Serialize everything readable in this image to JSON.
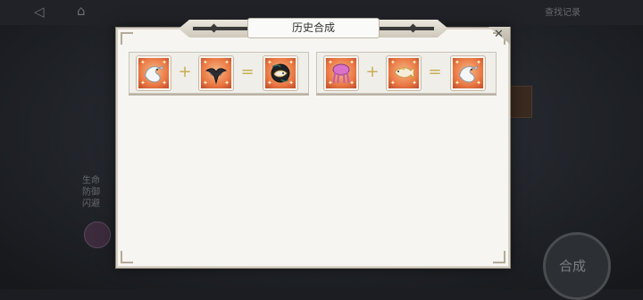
{
  "background": {
    "side_labels": [
      "生命",
      "防御",
      "闪避"
    ],
    "top_right_label": "查找记录",
    "bottom_button_label": "合成"
  },
  "dialog": {
    "title": "历史合成",
    "close_glyph": "✕",
    "recipes": [
      {
        "inputs": [
          {
            "icon": "white-dragon-icon"
          },
          {
            "icon": "black-bird-icon"
          }
        ],
        "output": {
          "icon": "black-gold-fish-icon"
        }
      },
      {
        "inputs": [
          {
            "icon": "pink-tentacle-icon"
          },
          {
            "icon": "golden-fish-icon"
          }
        ],
        "output": {
          "icon": "white-dragon-icon"
        }
      }
    ],
    "plus_symbol": "+",
    "equals_symbol": "="
  },
  "colors": {
    "panel": "#f7f5f1",
    "item_tile": "#ea7a45",
    "operator": "#c9ae55"
  }
}
